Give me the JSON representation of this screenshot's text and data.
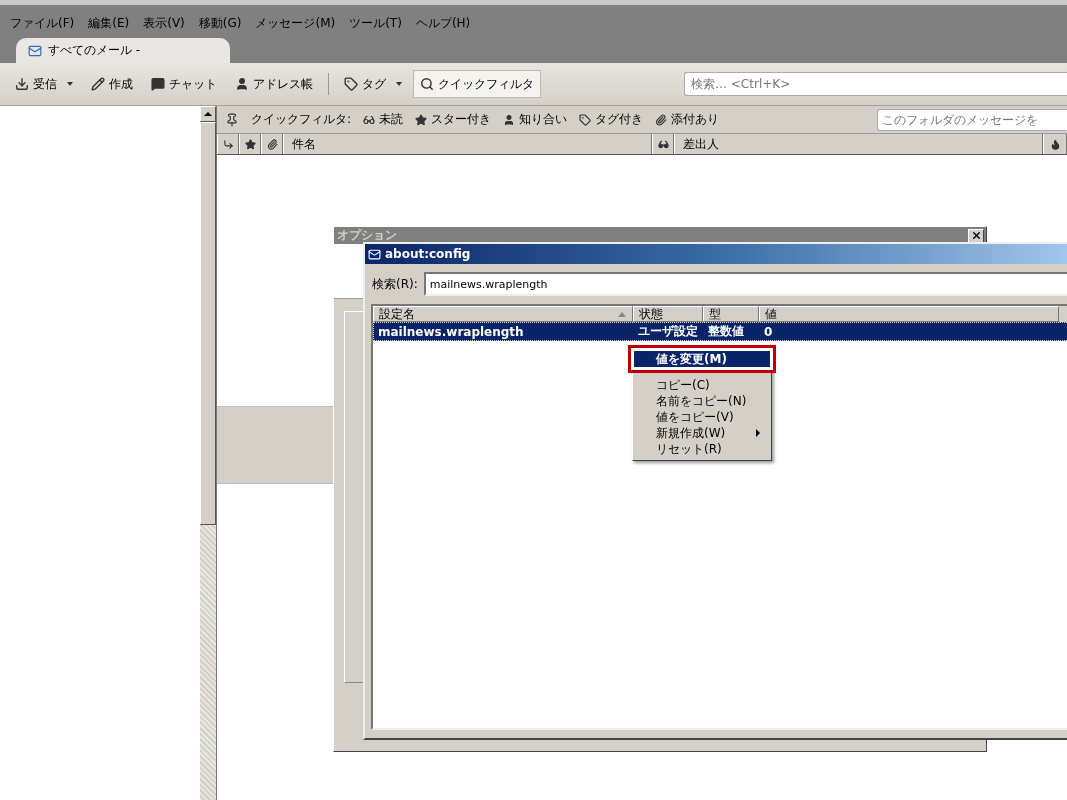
{
  "menu_bar": [
    "ファイル(F)",
    "編集(E)",
    "表示(V)",
    "移動(G)",
    "メッセージ(M)",
    "ツール(T)",
    "ヘルプ(H)"
  ],
  "tabs": [
    {
      "label": "すべてのメール -",
      "selected": true
    }
  ],
  "toolbar": [
    {
      "kind": "download",
      "label": "受信",
      "menu": true,
      "pressed": false
    },
    {
      "kind": "pencil",
      "label": "作成",
      "menu": false,
      "pressed": false
    },
    {
      "kind": "chat",
      "label": "チャット",
      "menu": false,
      "pressed": false
    },
    {
      "kind": "person",
      "label": "アドレス帳",
      "menu": false,
      "pressed": false
    },
    {
      "kind": "tag",
      "label": "タグ",
      "menu": true,
      "pressed": false
    },
    {
      "kind": "search",
      "label": "クイックフィルタ",
      "menu": false,
      "pressed": true
    }
  ],
  "search": {
    "placeholder": "検索… <Ctrl+K>"
  },
  "quick_filter": {
    "label": "クイックフィルタ:",
    "items": [
      {
        "kind": "glasses",
        "label": "未読"
      },
      {
        "kind": "star",
        "label": "スター付き"
      },
      {
        "kind": "person",
        "label": "知り合い"
      },
      {
        "kind": "tag",
        "label": "タグ付き"
      },
      {
        "kind": "clip",
        "label": "添付あり"
      }
    ],
    "search_placeholder": "このフォルダのメッセージを"
  },
  "thread_columns": [
    {
      "kind": "thread"
    },
    {
      "kind": "star"
    },
    {
      "kind": "clip"
    },
    {
      "kind": "text",
      "label": "件名"
    },
    {
      "kind": "glasses"
    },
    {
      "kind": "text",
      "label": "差出人"
    },
    {
      "kind": "flame"
    }
  ],
  "options_dialog": {
    "title": "オプション"
  },
  "config_window": {
    "title": "about:config",
    "search_label": "検索(R):",
    "search_value": "mailnews.wraplength",
    "columns": [
      "設定名",
      "状態",
      "型",
      "値"
    ],
    "rows": [
      {
        "name": "mailnews.wraplength",
        "status": "ユーザ設定",
        "type": "整数値",
        "value": "0",
        "selected": true
      }
    ]
  },
  "context_menu": [
    {
      "label": "値を変更(M)",
      "selected": true,
      "outlined": true,
      "submenu": false
    },
    {
      "label": "コピー(C)",
      "selected": false,
      "outlined": false,
      "submenu": false
    },
    {
      "label": "名前をコピー(N)",
      "selected": false,
      "outlined": false,
      "submenu": false
    },
    {
      "label": "値をコピー(V)",
      "selected": false,
      "outlined": false,
      "submenu": false
    },
    {
      "label": "新規作成(W)",
      "selected": false,
      "outlined": false,
      "submenu": true
    },
    {
      "label": "リセット(R)",
      "selected": false,
      "outlined": false,
      "submenu": false
    }
  ]
}
